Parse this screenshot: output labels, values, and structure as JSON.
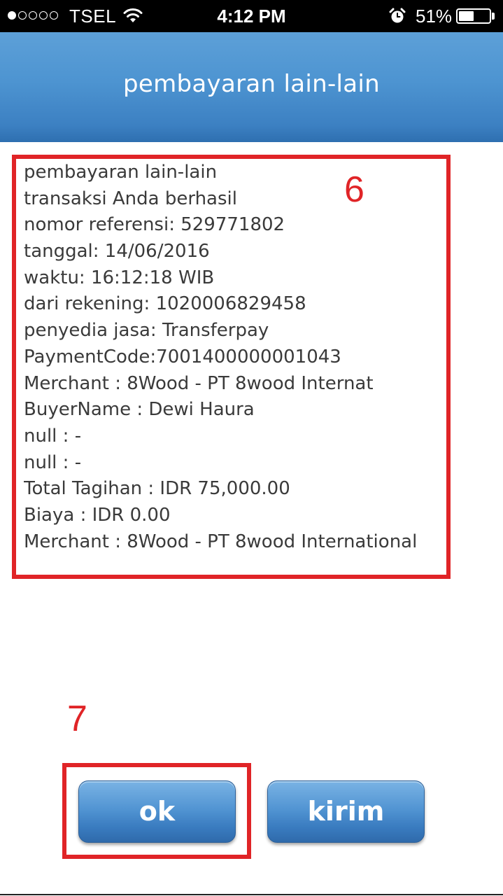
{
  "status_bar": {
    "carrier": "TSEL",
    "time": "4:12 PM",
    "battery": "51%",
    "battery_level": 0.51,
    "signal_bars_filled": 1,
    "signal_bars_total": 5,
    "icons": [
      "wifi-icon",
      "alarm-icon",
      "battery-icon"
    ]
  },
  "header": {
    "title": "pembayaran lain-lain"
  },
  "receipt": {
    "lines": [
      "pembayaran lain-lain",
      "transaksi Anda berhasil",
      "nomor referensi: 529771802",
      "tanggal: 14/06/2016",
      "waktu: 16:12:18 WIB",
      "dari rekening: 1020006829458",
      "penyedia jasa: Transferpay",
      "PaymentCode:7001400000001043",
      "Merchant : 8Wood - PT 8wood Internat",
      "BuyerName : Dewi Haura",
      "null : -",
      "null : -",
      "Total Tagihan : IDR 75,000.00",
      "Biaya : IDR 0.00",
      "Merchant : 8Wood - PT 8wood International"
    ]
  },
  "annotations": {
    "receipt_step": "6",
    "ok_step": "7",
    "color": "#e02427"
  },
  "buttons": {
    "ok_label": "ok",
    "kirim_label": "kirim"
  },
  "colors": {
    "header_blue": "#4d94d1",
    "button_blue": "#3a7cc0",
    "text": "#3a3a3a"
  }
}
